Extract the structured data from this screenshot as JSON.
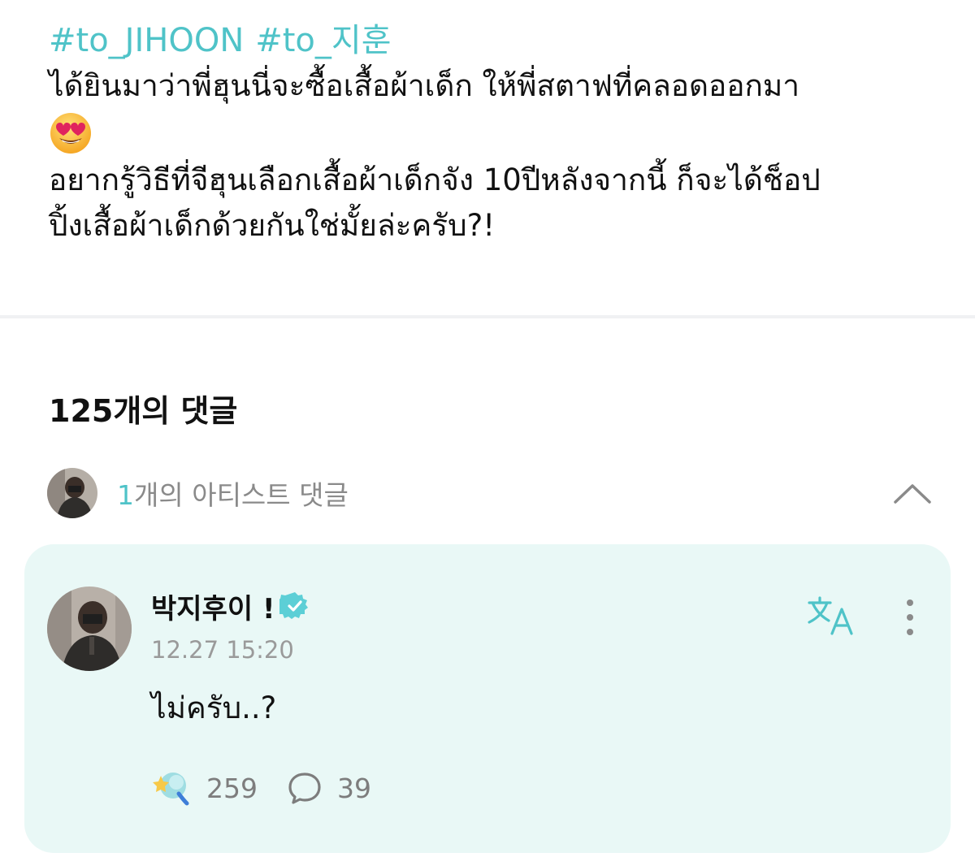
{
  "post": {
    "hashtags": [
      "#to_JIHOON",
      "#to_지훈"
    ],
    "line1": "ได้ยินมาว่าพี่ฮุนนี่จะซื้อเสื้อผ้าเด็ก ให้พี่สตาฟที่คลอดออกมา",
    "emoji": "smiling-face-with-heart-eyes",
    "line2": "อยากรู้วิธีที่จีฮุนเลือกเสื้อผ้าเด็กจัง 10ปีหลังจากนี้ ก็จะได้ช็อป",
    "line3": "ปิ้งเสื้อผ้าเด็กด้วยกันใช่มั้ยล่ะครับ?!"
  },
  "comments": {
    "count_label": "125개의 댓글",
    "artist_summary": {
      "count": "1",
      "label": "개의 아티스트 댓글"
    }
  },
  "artist_comment": {
    "author": "박지후이 !",
    "timestamp": "12.27 15:20",
    "text": "ไม่ครับ..?",
    "likes": "259",
    "replies": "39"
  },
  "colors": {
    "accent": "#4fc3c8",
    "card_bg": "#e9f8f6",
    "verified": "#5ccfd6"
  },
  "icons": [
    "chevron-up-icon",
    "verified-badge-icon",
    "translate-icon",
    "more-vertical-icon",
    "like-reaction-icon",
    "comment-bubble-icon"
  ]
}
